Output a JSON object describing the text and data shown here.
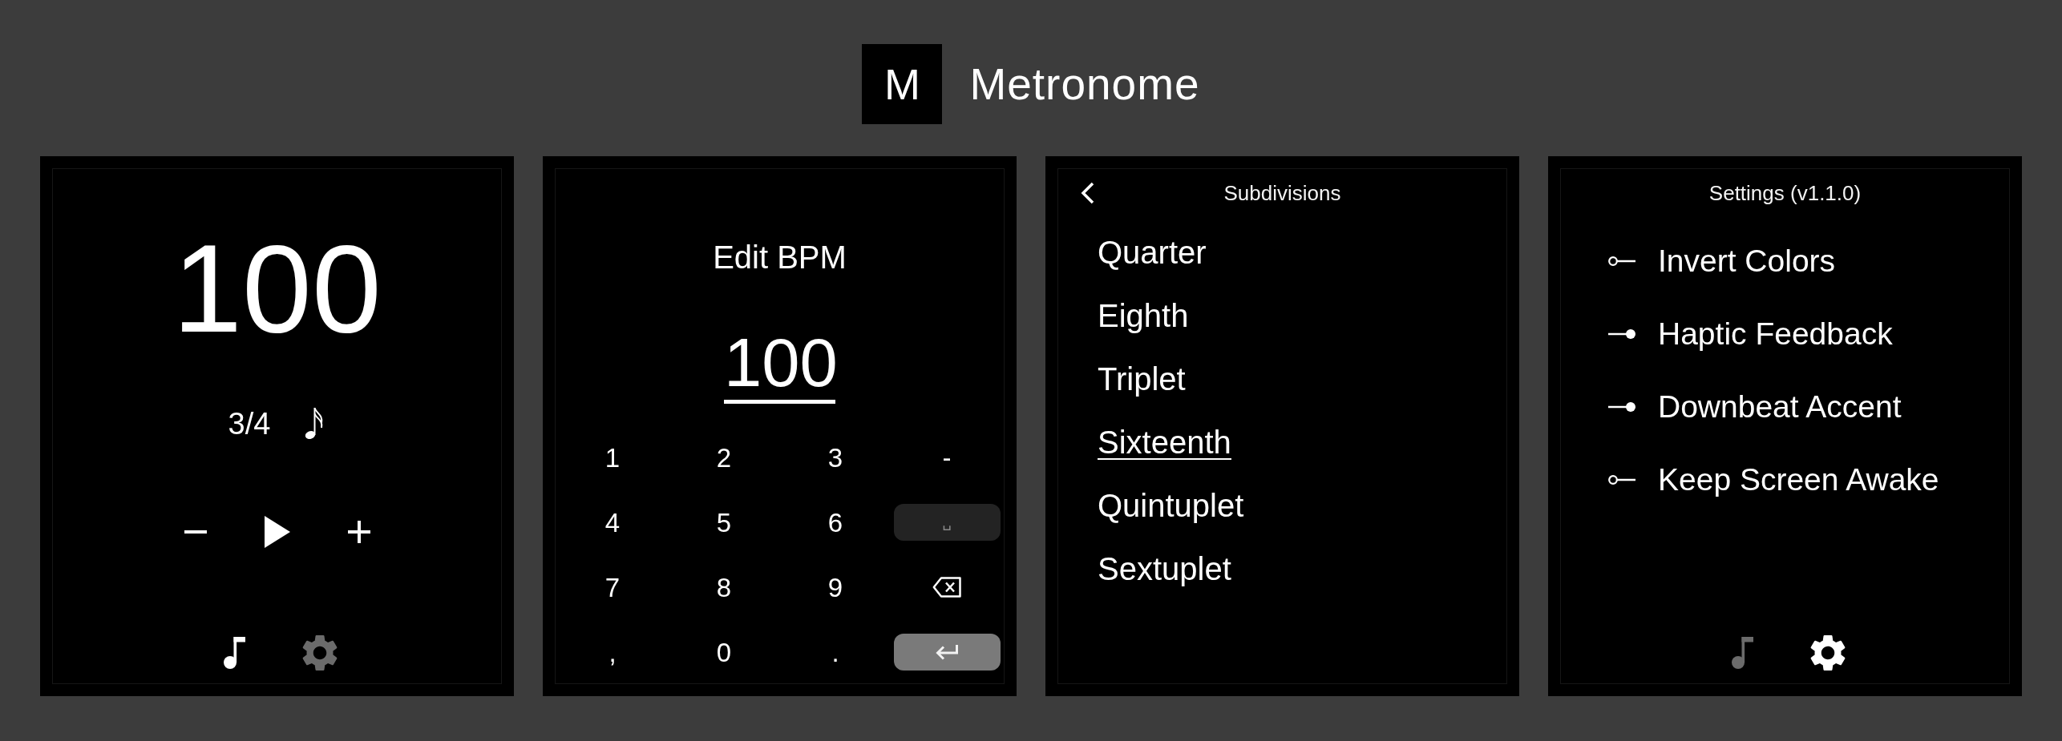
{
  "header": {
    "logo_letter": "M",
    "title": "Metronome"
  },
  "screens": [
    {
      "kind": "main",
      "tempo": "100",
      "time_signature": "3/4",
      "nav": [
        {
          "kind": "music",
          "selected": true
        },
        {
          "kind": "settings",
          "selected": false
        }
      ]
    },
    {
      "kind": "edit_bpm",
      "title": "Edit BPM",
      "value": "100",
      "keys": [
        {
          "kind": "char",
          "label": "1"
        },
        {
          "kind": "char",
          "label": "2"
        },
        {
          "kind": "char",
          "label": "3"
        },
        {
          "kind": "char",
          "label": "-"
        },
        {
          "kind": "char",
          "label": "4"
        },
        {
          "kind": "char",
          "label": "5"
        },
        {
          "kind": "char",
          "label": "6"
        },
        {
          "kind": "space",
          "label": "␣"
        },
        {
          "kind": "char",
          "label": "7"
        },
        {
          "kind": "char",
          "label": "8"
        },
        {
          "kind": "char",
          "label": "9"
        },
        {
          "kind": "backspace"
        },
        {
          "kind": "char",
          "label": ","
        },
        {
          "kind": "char",
          "label": "0"
        },
        {
          "kind": "char",
          "label": "."
        },
        {
          "kind": "enter"
        }
      ]
    },
    {
      "kind": "subdivisions",
      "title": "Subdivisions",
      "items": [
        {
          "label": "Quarter",
          "selected": false
        },
        {
          "label": "Eighth",
          "selected": false
        },
        {
          "label": "Triplet",
          "selected": false
        },
        {
          "label": "Sixteenth",
          "selected": true
        },
        {
          "label": "Quintuplet",
          "selected": false
        },
        {
          "label": "Sextuplet",
          "selected": false
        }
      ]
    },
    {
      "kind": "settings",
      "title": "Settings (v1.1.0)",
      "toggles": [
        {
          "label": "Invert Colors",
          "checked": false
        },
        {
          "label": "Haptic Feedback",
          "checked": true
        },
        {
          "label": "Downbeat Accent",
          "checked": true
        },
        {
          "label": "Keep Screen Awake",
          "checked": false
        }
      ],
      "nav": [
        {
          "kind": "music",
          "selected": false
        },
        {
          "kind": "settings",
          "selected": true
        }
      ]
    }
  ]
}
